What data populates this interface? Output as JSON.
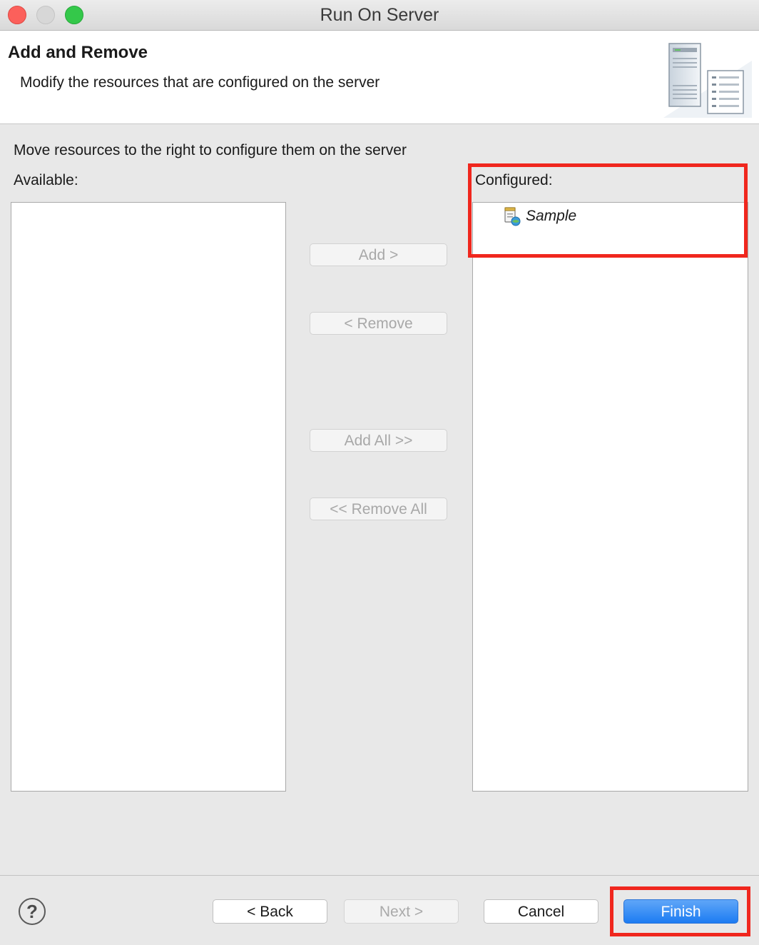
{
  "window": {
    "title": "Run On Server"
  },
  "header": {
    "title": "Add and Remove",
    "description": "Modify the resources that are configured on the server",
    "banner_icon": "server-config-icon"
  },
  "main": {
    "instructions": "Move resources to the right to configure them on the server",
    "available_label": "Available:",
    "configured_label": "Configured:",
    "available_items": [],
    "configured_items": [
      {
        "label": "Sample",
        "icon": "web-module-icon"
      }
    ],
    "buttons": {
      "add": "Add >",
      "remove": "< Remove",
      "add_all": "Add All >>",
      "remove_all": "<< Remove All"
    }
  },
  "footer": {
    "help_icon": "help-icon",
    "help_glyph": "?",
    "back": "< Back",
    "next": "Next >",
    "cancel": "Cancel",
    "finish": "Finish"
  },
  "colors": {
    "highlight": "#f0271e",
    "primary_button": "#1d7cf2"
  }
}
